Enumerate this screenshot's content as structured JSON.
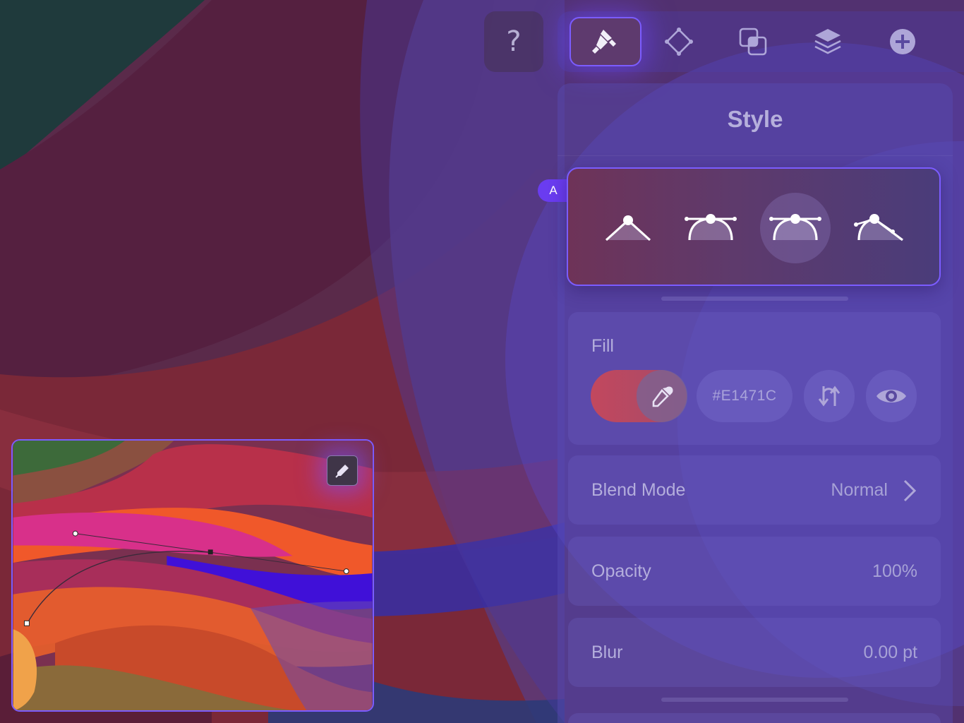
{
  "toolbar": {
    "help_label": "?",
    "tabs": [
      {
        "icon": "brush-icon",
        "active": true
      },
      {
        "icon": "transform-icon",
        "active": false
      },
      {
        "icon": "boolean-icon",
        "active": false
      },
      {
        "icon": "layers-icon",
        "active": false
      },
      {
        "icon": "add-icon",
        "active": false
      }
    ]
  },
  "panel": {
    "title": "Style",
    "badge": "A",
    "node_types": [
      {
        "icon": "corner-node-icon",
        "selected": false
      },
      {
        "icon": "smooth-node-icon",
        "selected": false
      },
      {
        "icon": "symmetric-node-icon",
        "selected": true
      },
      {
        "icon": "asymmetric-node-icon",
        "selected": false
      }
    ]
  },
  "fill": {
    "label": "Fill",
    "hex": "#E1471C",
    "swatch_color": "#E1471C"
  },
  "blend": {
    "label": "Blend Mode",
    "value": "Normal"
  },
  "opacity": {
    "label": "Opacity",
    "value": "100%"
  },
  "blur": {
    "label": "Blur",
    "value": "0.00 pt"
  },
  "colors": {
    "accent": "#7B5CFF",
    "badge": "#6A3CF0"
  }
}
